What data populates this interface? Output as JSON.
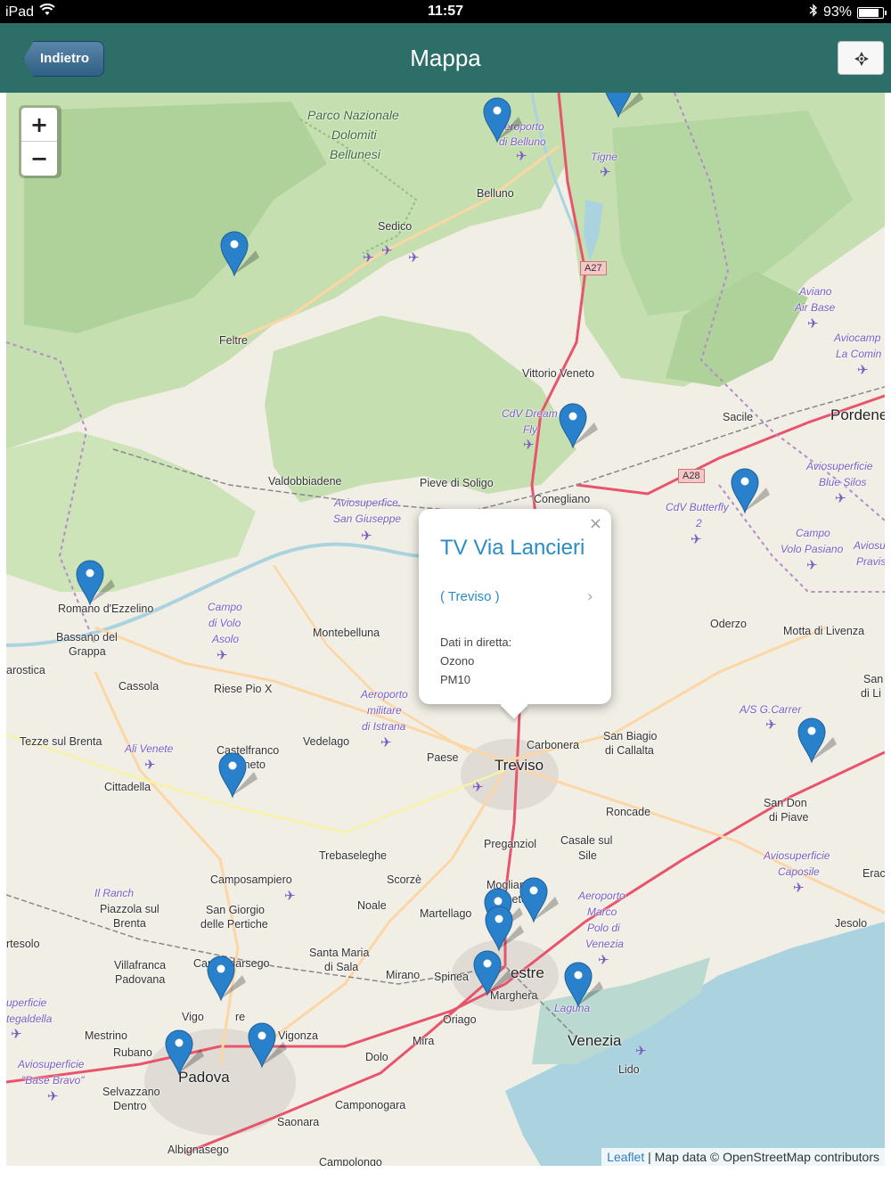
{
  "status_bar": {
    "device": "iPad",
    "time": "11:57",
    "battery": "93%",
    "battery_level": 0.93
  },
  "nav": {
    "back_label": "Indietro",
    "title": "Mappa"
  },
  "zoom": {
    "in_label": "+",
    "out_label": "−"
  },
  "popup": {
    "close": "×",
    "title": "TV Via Lancieri",
    "link": "( Treviso )",
    "live_label": "Dati in diretta:",
    "pollutants": [
      "Ozono",
      "PM10"
    ]
  },
  "attribution": {
    "leaflet": "Leaflet",
    "text": " | Map data © OpenStreetMap contributors"
  },
  "places": {
    "park1": "Parco Nazionale",
    "park2": "Dolomiti",
    "park3": "Bellunesi",
    "aero_belluno1": "Aeroporto",
    "aero_belluno2": "di Belluno",
    "belluno": "Belluno",
    "tigne": "Tigne",
    "sedico": "Sedico",
    "feltre": "Feltre",
    "a27": "A27",
    "a28": "A28",
    "aviano1": "Aviano",
    "aviano2": "Air Base",
    "aviocamp1": "Aviocamp",
    "aviocamp2": "La Comin",
    "vittorio": "Vittorio Veneto",
    "sacile": "Sacile",
    "pordenone": "Pordene",
    "cdv1": "CdV Dream",
    "cdv2": "Fly",
    "valdobbiadene": "Valdobbiadene",
    "pieve": "Pieve di Soligo",
    "conegliano": "Conegliano",
    "avsg1": "Aviosuperfice",
    "avsg2": "San Giuseppe",
    "avbs1": "Aviosuperficie",
    "avbs2": "Blue Silos",
    "cdvb1": "CdV Butterfly",
    "cdvb2": "2",
    "campo1": "Campo",
    "campo2": "Volo Pasiano",
    "aviosp1": "Aviosu",
    "aviosp2": "Pravis",
    "romano": "Romano d'Ezzelino",
    "bassano1": "Bassano del",
    "bassano2": "Grappa",
    "campoasolo1": "Campo",
    "campoasolo2": "di Volo",
    "campoasolo3": "Asolo",
    "montebelluna": "Montebelluna",
    "oderzo": "Oderzo",
    "motta": "Motta di Livenza",
    "rostica": "arostica",
    "cassola": "Cassola",
    "riese": "Riese Pio X",
    "istrana1": "Aeroporto",
    "istrana2": "militare",
    "istrana3": "di Istrana",
    "carbonera": "Carbonera",
    "sanbiagio1": "San Biagio",
    "sanbiagio2": "di Callalta",
    "gcarrer": "A/S G.Carrer",
    "san1": "San",
    "san2": "di Li",
    "tezze": "Tezze sul Brenta",
    "alivenete": "Ali Venete",
    "castelfranco1": "Castelfranco",
    "castelfranco2": "Veneto",
    "vedelago": "Vedelago",
    "paese": "Paese",
    "treviso": "Treviso",
    "cittadella": "Cittadella",
    "roncade": "Roncade",
    "sandona1": "San Don",
    "sandona2": "di Piave",
    "preganziol": "Preganziol",
    "casale1": "Casale sul",
    "casale2": "Sile",
    "trebaseleghe": "Trebaseleghe",
    "caposile1": "Aviosuperficie",
    "caposile2": "Caposile",
    "erac": "Erac",
    "camposampiero": "Camposampiero",
    "scorze": "Scorzè",
    "mogliano1": "Mogliano",
    "mogliano2": "Veneto",
    "ilranch": "Il Ranch",
    "piazzola1": "Piazzola sul",
    "piazzola2": "Brenta",
    "sangiorgio1": "San Giorgio",
    "sangiorgio2": "delle Pertiche",
    "noale": "Noale",
    "martellago": "Martellago",
    "marco1": "Aeroporto",
    "marco2": "Marco",
    "marco3": "Polo di",
    "marco4": "Venezia",
    "jesolo": "Jesolo",
    "rtesolo": "rtesolo",
    "santamaria1": "Santa Maria",
    "santamaria2": "di Sala",
    "villafranca1": "Villafranca",
    "villafranca2": "Padovana",
    "campodarsego": "Campodarsego",
    "mirano": "Mirano",
    "spinea": "Spinea",
    "mestre": "estre",
    "marghera": "Marghera",
    "sup1": "uperficie",
    "sup2": "tegaldella",
    "vigodarzere": "Vigo",
    "vigodarzere_re": "re",
    "oriago": "Oriago",
    "laguna": "Laguna",
    "venezia": "Venezia",
    "mestrino": "Mestrino",
    "vigonza": "Vigonza",
    "mira": "Mira",
    "rubano": "Rubano",
    "dolo": "Dolo",
    "lido": "Lido",
    "bravo1": "Aviosuperficie",
    "bravo2": "\"Base Bravo\"",
    "padova": "Padova",
    "selvazzano1": "Selvazzano",
    "selvazzano2": "Dentro",
    "camponogara": "Camponogara",
    "saonara": "Saonara",
    "albignasego": "Albignasego",
    "campolongo": "Campolongo"
  },
  "colors": {
    "nav_bg": "#2e6e68",
    "marker_blue": "#2a81cb",
    "link_blue": "#2a8cc9"
  }
}
